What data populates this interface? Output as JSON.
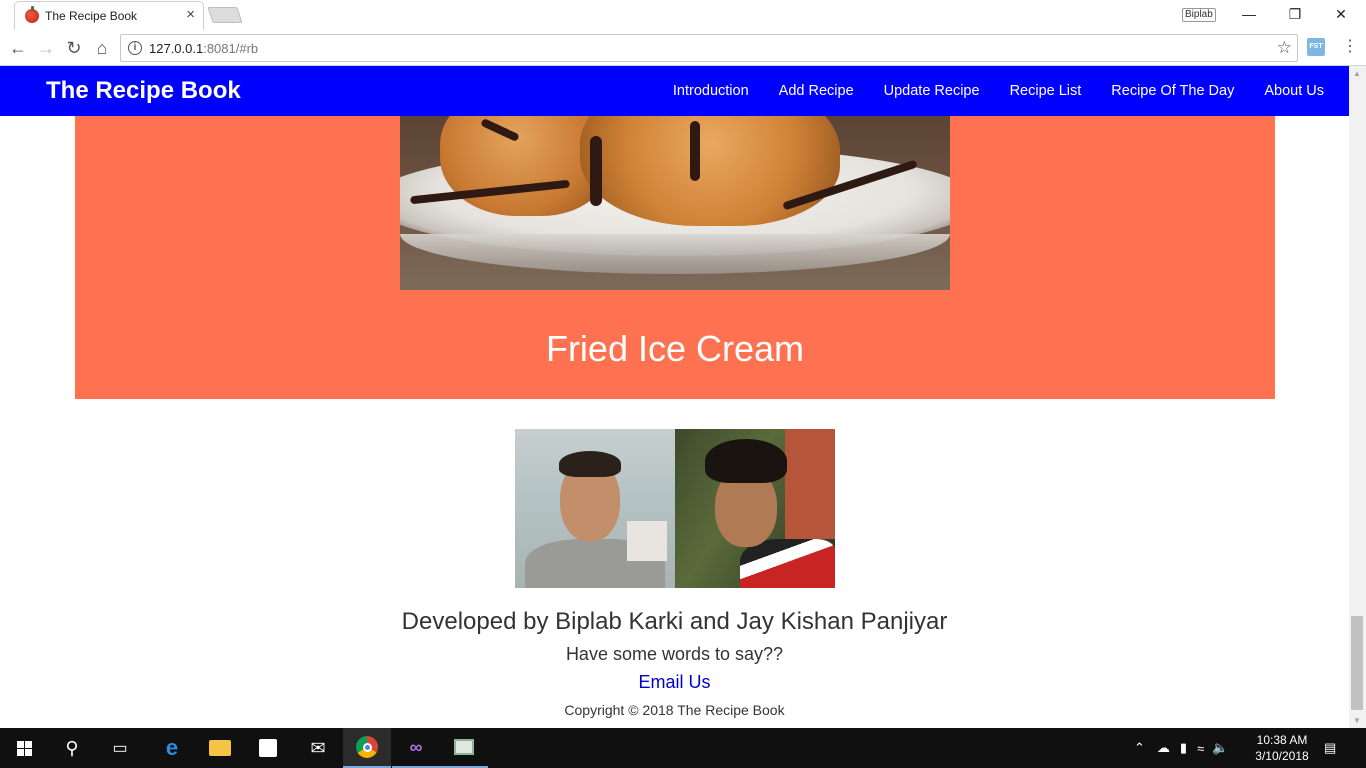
{
  "browser": {
    "tab_title": "The Recipe Book",
    "tab_close": "×",
    "profile_name": "Biplab",
    "url_host": "127.0.0.1",
    "url_rest": ":8081/#rb",
    "ext_label": "FST"
  },
  "site": {
    "brand": "The Recipe Book",
    "nav": [
      "Introduction",
      "Add Recipe",
      "Update Recipe",
      "Recipe List",
      "Recipe Of The Day",
      "About Us"
    ],
    "nav_color": "#0000ff"
  },
  "recipe": {
    "title": "Fried Ice Cream",
    "card_color": "#ff7251"
  },
  "footer": {
    "credit": "Developed by Biplab Karki and Jay Kishan Panjiyar",
    "words": "Have some words to say??",
    "email_link": "Email Us",
    "copyright": "Copyright © 2018 The Recipe Book"
  },
  "taskbar": {
    "time": "10:38 AM",
    "date": "3/10/2018",
    "icons": [
      "windows-start",
      "search",
      "task-view",
      "edge",
      "file-explorer",
      "store",
      "mail",
      "chrome",
      "visual-studio",
      "app"
    ]
  }
}
